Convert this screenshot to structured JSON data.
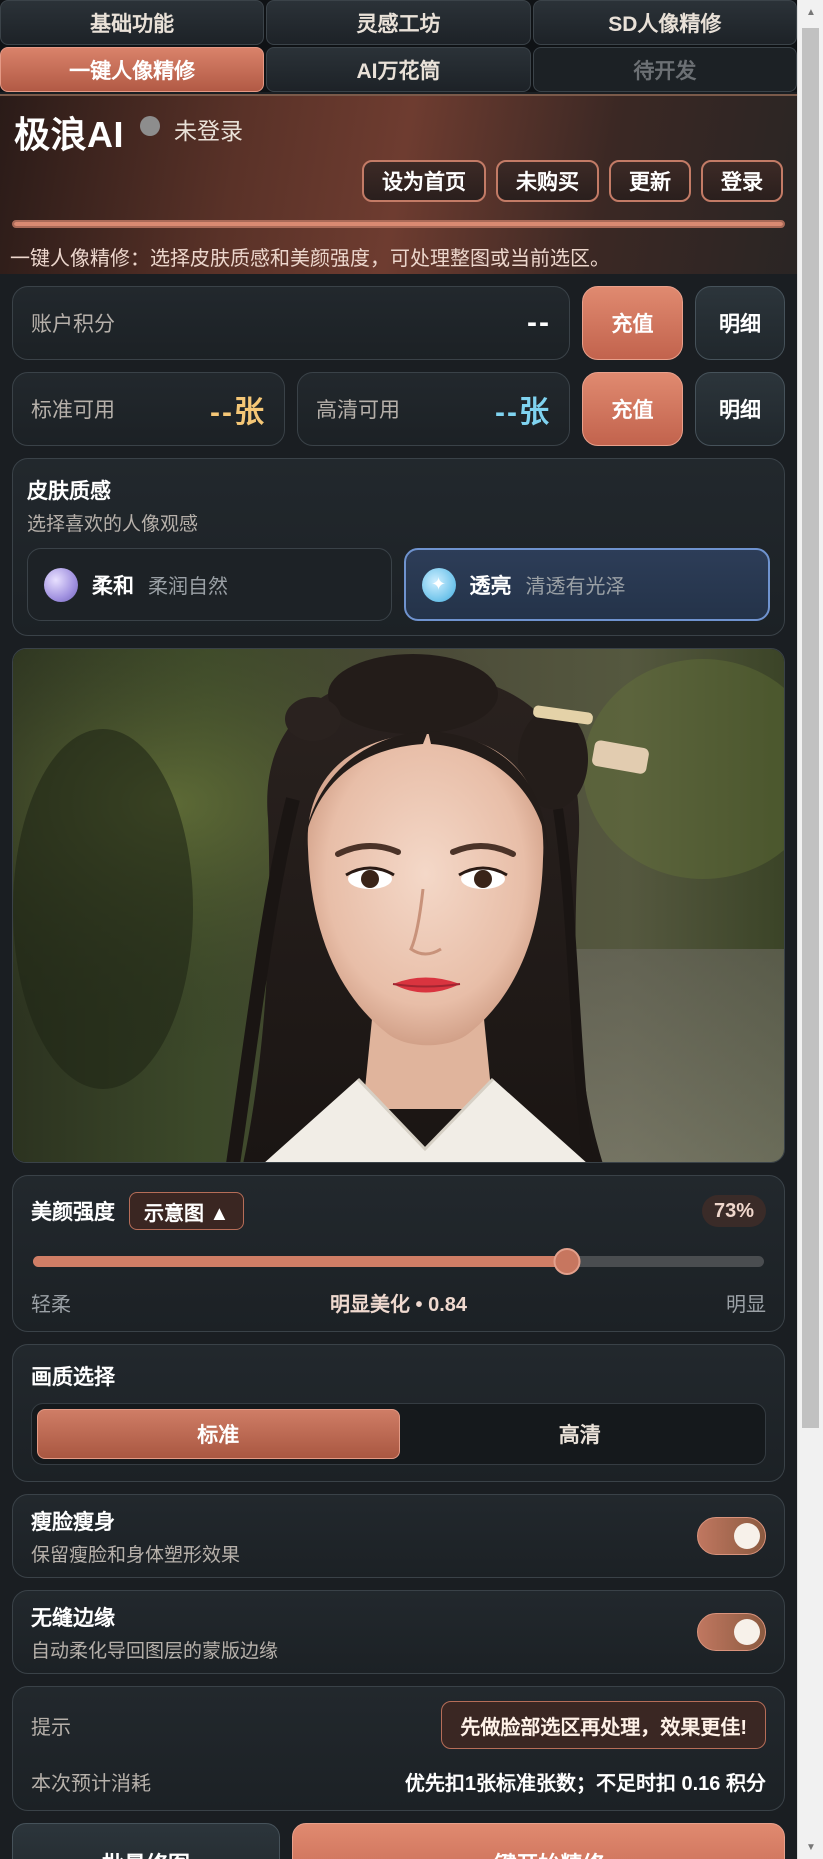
{
  "tabs": [
    {
      "label": "基础功能",
      "state": "normal"
    },
    {
      "label": "灵感工坊",
      "state": "normal"
    },
    {
      "label": "SD人像精修",
      "state": "normal"
    },
    {
      "label": "一键人像精修",
      "state": "active"
    },
    {
      "label": "AI万花筒",
      "state": "normal"
    },
    {
      "label": "待开发",
      "state": "disabled"
    }
  ],
  "header": {
    "brand": "极浪AI",
    "login_status": "未登录",
    "buttons": [
      "设为首页",
      "未购买",
      "更新",
      "登录"
    ],
    "progress": 1.0,
    "hint": "一键人像精修：选择皮肤质感和美颜强度，可处理整图或当前选区。"
  },
  "account": {
    "points_label": "账户积分",
    "points_value": "--",
    "recharge": "充值",
    "detail": "明细",
    "standard_label": "标准可用",
    "standard_value": "--张",
    "hd_label": "高清可用",
    "hd_value": "--张"
  },
  "skin": {
    "title": "皮肤质感",
    "subtitle": "选择喜欢的人像观感",
    "options": [
      {
        "name": "柔和",
        "desc": "柔润自然",
        "icon": "sphere-icon",
        "selected": false
      },
      {
        "name": "透亮",
        "desc": "清透有光泽",
        "icon": "sparkle-icon",
        "selected": true
      }
    ]
  },
  "beauty": {
    "title": "美颜强度",
    "demo_label": "示意图 ▲",
    "percent_label": "73%",
    "value": 0.73,
    "min_label": "轻柔",
    "mid_label": "明显美化 • 0.84",
    "max_label": "明显"
  },
  "quality": {
    "title": "画质选择",
    "options": [
      "标准",
      "高清"
    ],
    "selected": "标准"
  },
  "toggles": [
    {
      "title": "瘦脸瘦身",
      "desc": "保留瘦脸和身体塑形效果",
      "on": true
    },
    {
      "title": "无缝边缘",
      "desc": "自动柔化导回图层的蒙版边缘",
      "on": true
    }
  ],
  "tips": {
    "tip_label": "提示",
    "tip_text": "先做脸部选区再处理，效果更佳!",
    "cost_label": "本次预计消耗",
    "cost_text": "优先扣1张标准张数；不足时扣 0.16 积分"
  },
  "bottom": {
    "batch": "批量修图",
    "start": "一键开始精修"
  }
}
